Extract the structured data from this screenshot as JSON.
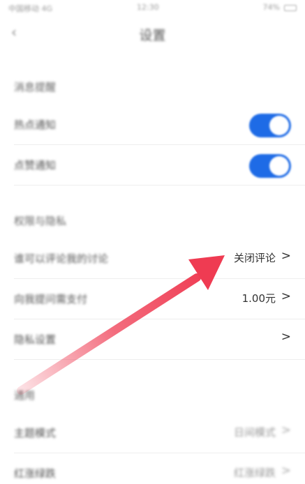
{
  "status_bar": {
    "left": "中国移动 4G",
    "time": "12:30",
    "right": "74%"
  },
  "nav": {
    "back_icon": "chevron-left-icon",
    "title": "设置"
  },
  "sections": {
    "notifications": {
      "title": "消息提醒",
      "items": [
        {
          "label": "热点通知",
          "toggle": "on"
        },
        {
          "label": "点赞通知",
          "toggle": "on"
        }
      ]
    },
    "privacy": {
      "title": "权限与隐私",
      "items": [
        {
          "label": "谁可以评论我的讨论",
          "value": "关闭评论"
        },
        {
          "label": "向我提问需支付",
          "value": "1.00元"
        },
        {
          "label": "隐私设置",
          "value": ""
        }
      ]
    },
    "general": {
      "title": "通用",
      "items": [
        {
          "label": "主题模式",
          "value": "日间模式"
        },
        {
          "label": "红涨绿跌",
          "value": "红涨绿跌"
        }
      ]
    }
  },
  "colors": {
    "toggle_on": "#1e6be6",
    "annotation_arrow": "#ef3b52"
  },
  "icons": {
    "chevron": "chevron-right-icon",
    "annotation": "red-arrow-annotation"
  }
}
